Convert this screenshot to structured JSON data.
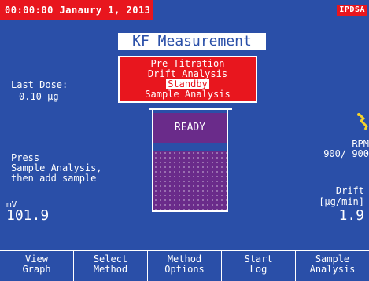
{
  "header": {
    "datetime": "00:00:00 Janaury 1, 2013",
    "badge": "IPDSA"
  },
  "title": "KF Measurement",
  "status_menu": {
    "items": [
      "Pre-Titration",
      "Drift Analysis",
      "Standby",
      "Sample Analysis"
    ],
    "highlighted": "Standby"
  },
  "last_dose": {
    "label": "Last Dose:",
    "value": "0.10 µg"
  },
  "beaker": {
    "state": "READY"
  },
  "instruction": {
    "line1": "Press",
    "line2": "Sample Analysis,",
    "line3": "then add sample"
  },
  "rpm": {
    "label": "RPM",
    "value": "900/ 900"
  },
  "mv": {
    "unit": "mV",
    "value": "101.9"
  },
  "drift": {
    "label": "Drift",
    "unit": "[µg/min]",
    "value": "1.9"
  },
  "softkeys": [
    {
      "line1": "View",
      "line2": "Graph"
    },
    {
      "line1": "Select",
      "line2": "Method"
    },
    {
      "line1": "Method",
      "line2": "Options"
    },
    {
      "line1": "Start",
      "line2": "Log"
    },
    {
      "line1": "Sample",
      "line2": "Analysis"
    }
  ],
  "icons": {
    "probe": "probe-icon"
  },
  "colors": {
    "background": "#2a4fa8",
    "accent_red": "#e8161e",
    "beaker_purple": "#6a2b8a",
    "text": "#ffffff"
  }
}
